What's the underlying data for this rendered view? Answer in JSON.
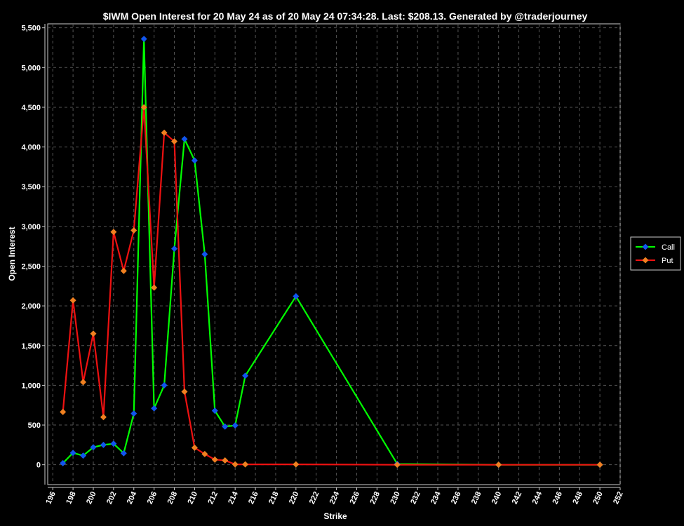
{
  "chart_data": {
    "type": "line",
    "title": "$IWM Open Interest for 20 May 24 as of 20 May 24 07:34:28.  Last: $208.13.  Generated by @traderjourney",
    "xlabel": "Strike",
    "ylabel": "Open Interest",
    "xlim": [
      195.5,
      252
    ],
    "ylim": [
      -250,
      5550
    ],
    "x_ticks": [
      196,
      198,
      200,
      202,
      204,
      206,
      208,
      210,
      212,
      214,
      216,
      218,
      220,
      222,
      224,
      226,
      228,
      230,
      232,
      234,
      236,
      238,
      240,
      242,
      244,
      246,
      248,
      250,
      252
    ],
    "y_ticks": [
      0,
      500,
      1000,
      1500,
      2000,
      2500,
      3000,
      3500,
      4000,
      4500,
      5000,
      5500
    ],
    "y_tick_labels": [
      "0",
      "500",
      "1,000",
      "1,500",
      "2,000",
      "2,500",
      "3,000",
      "3,500",
      "4,000",
      "4,500",
      "5,000",
      "5,500"
    ],
    "grid": true,
    "legend_position": "right",
    "series": [
      {
        "name": "Call",
        "color": "#00ff00",
        "marker_color": "#1155ee",
        "x": [
          197,
          198,
          199,
          200,
          201,
          202,
          203,
          204,
          205,
          206,
          207,
          208,
          209,
          210,
          211,
          212,
          213,
          214,
          215,
          220,
          230,
          240,
          250
        ],
        "y": [
          20,
          150,
          115,
          220,
          250,
          265,
          145,
          645,
          5360,
          710,
          1000,
          2720,
          4100,
          3830,
          2650,
          680,
          480,
          495,
          1120,
          2120,
          10,
          0,
          0
        ]
      },
      {
        "name": "Put",
        "color": "#ee1111",
        "marker_color": "#f08020",
        "x": [
          197,
          198,
          199,
          200,
          201,
          202,
          203,
          204,
          205,
          206,
          207,
          208,
          209,
          210,
          211,
          212,
          213,
          214,
          215,
          220,
          230,
          240,
          250
        ],
        "y": [
          665,
          2070,
          1040,
          1650,
          600,
          2930,
          2440,
          2950,
          4500,
          2230,
          4180,
          4070,
          920,
          215,
          135,
          65,
          55,
          5,
          5,
          5,
          0,
          0,
          0
        ]
      }
    ]
  }
}
